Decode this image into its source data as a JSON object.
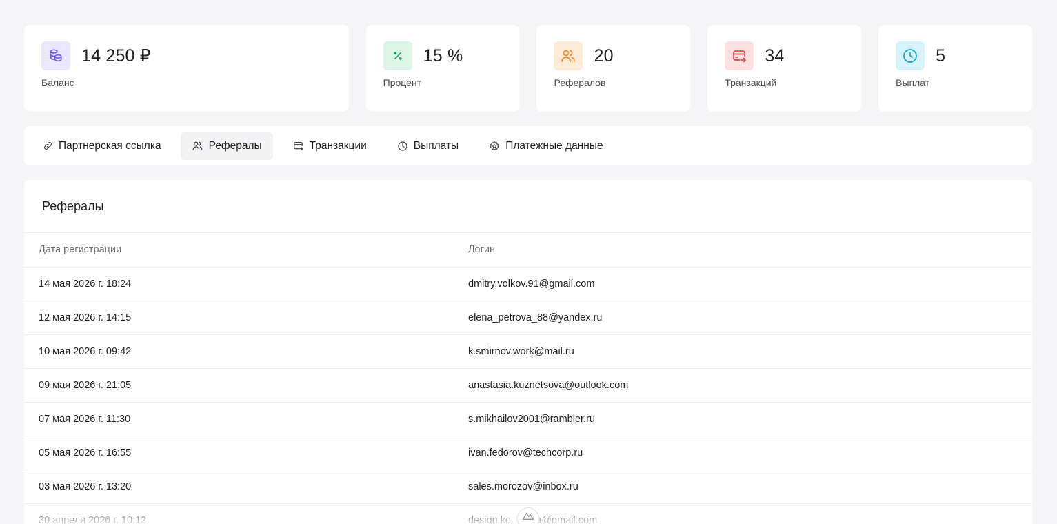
{
  "stats": [
    {
      "value": "14 250 ₽",
      "label": "Баланс",
      "icon": "coins-icon",
      "color": "#6d5cf5",
      "bg": "#e9e6fd"
    },
    {
      "value": "15 %",
      "label": "Процент",
      "icon": "percent-icon",
      "color": "#1aa863",
      "bg": "#dcf5e7"
    },
    {
      "value": "20",
      "label": "Рефералов",
      "icon": "users-icon",
      "color": "#f08a24",
      "bg": "#fdebd8"
    },
    {
      "value": "34",
      "label": "Транзакций",
      "icon": "card-transfer-icon",
      "color": "#e5484d",
      "bg": "#fde0e0"
    },
    {
      "value": "5",
      "label": "Выплат",
      "icon": "clock-icon",
      "color": "#1aa3c9",
      "bg": "#d6f2fa"
    }
  ],
  "tabs": [
    {
      "label": "Партнерская ссылка",
      "icon": "link-icon",
      "active": false
    },
    {
      "label": "Рефералы",
      "icon": "users-icon",
      "active": true
    },
    {
      "label": "Транзакции",
      "icon": "card-transfer-icon",
      "active": false
    },
    {
      "label": "Выплаты",
      "icon": "clock-icon",
      "active": false
    },
    {
      "label": "Платежные данные",
      "icon": "gear-icon",
      "active": false
    }
  ],
  "panel": {
    "title": "Рефералы",
    "columns": [
      "Дата регистрации",
      "Логин"
    ],
    "rows": [
      [
        "14 мая 2026 г. 18:24",
        "dmitry.volkov.91@gmail.com"
      ],
      [
        "12 мая 2026 г. 14:15",
        "elena_petrova_88@yandex.ru"
      ],
      [
        "10 мая 2026 г. 09:42",
        "k.smirnov.work@mail.ru"
      ],
      [
        "09 мая 2026 г. 21:05",
        "anastasia.kuznetsova@outlook.com"
      ],
      [
        "07 мая 2026 г. 11:30",
        "s.mikhailov2001@rambler.ru"
      ],
      [
        "05 мая 2026 г. 16:55",
        "ivan.fedorov@techcorp.ru"
      ],
      [
        "03 мая 2026 г. 13:20",
        "sales.morozov@inbox.ru"
      ],
      [
        "30 апреля 2026 г. 10:12",
        "design.ko  va@gmail.com"
      ]
    ]
  },
  "colors": {
    "accent": "#1f2024",
    "muted": "#6b6c73",
    "active_tab_bg": "#f2f2f4"
  }
}
